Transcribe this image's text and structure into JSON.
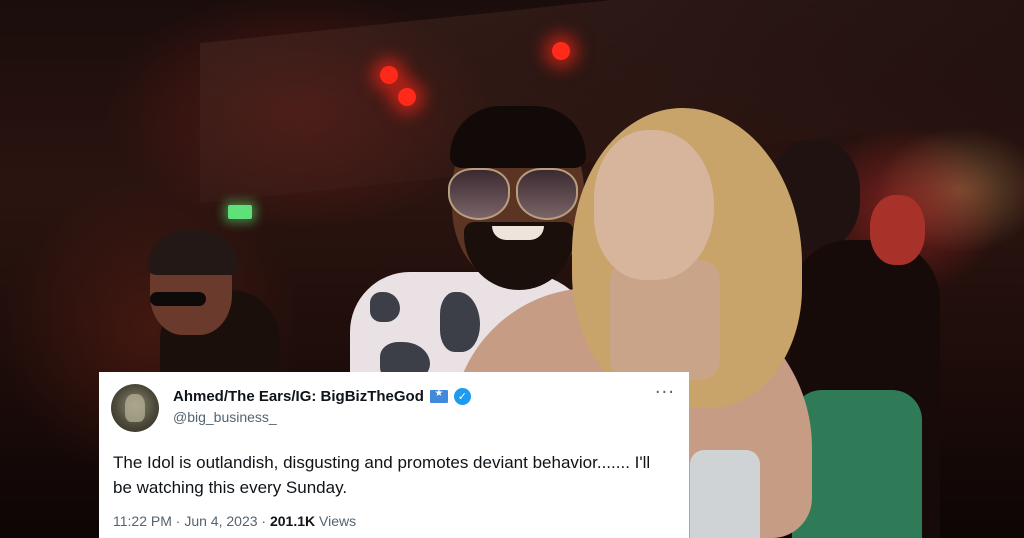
{
  "tweet": {
    "display_name": "Ahmed/The Ears/IG: BigBizTheGod",
    "handle": "@big_business_",
    "text": "The Idol is outlandish, disgusting and promotes deviant behavior....... I'll be watching this every Sunday.",
    "time": "11:22 PM",
    "separator": "·",
    "date": "Jun 4, 2023",
    "views_count": "201.1K",
    "views_label": "Views",
    "more_icon": "more-options-icon",
    "verified_icon": "verified-badge-icon",
    "flag_icon": "flag-icon",
    "colors": {
      "verified": "#1d9bf0",
      "text_primary": "#0f1419",
      "text_secondary": "#536471",
      "card_background": "#ffffff"
    }
  }
}
